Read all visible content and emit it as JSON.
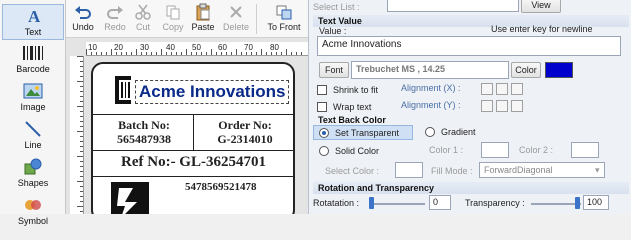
{
  "tools": [
    {
      "label": "Text",
      "icon": "text-tool-icon"
    },
    {
      "label": "Barcode",
      "icon": "barcode-icon"
    },
    {
      "label": "Image",
      "icon": "image-icon"
    },
    {
      "label": "Line",
      "icon": "line-icon"
    },
    {
      "label": "Shapes",
      "icon": "shapes-icon"
    },
    {
      "label": "Symbol",
      "icon": "symbol-icon"
    }
  ],
  "toolbar": {
    "undo": "Undo",
    "redo": "Redo",
    "cut": "Cut",
    "copy": "Copy",
    "paste": "Paste",
    "delete": "Delete",
    "to_front": "To Front"
  },
  "ruler": {
    "labels": [
      "10",
      "20",
      "30",
      "40",
      "50",
      "60",
      "70",
      "80"
    ]
  },
  "label": {
    "company": "Acme Innovations",
    "batch_title": "Batch No:",
    "batch_value": "565487938",
    "order_title": "Order No:",
    "order_value": "G-2314010",
    "ref": "Ref No:-  GL-36254701",
    "barcode_number": "5478569521478"
  },
  "panel": {
    "select_list_label": "Select List :",
    "view_button": "View",
    "text_value_header": "Text Value",
    "value_label": "Value :",
    "hint": "Use enter key for newline",
    "value_text": "Acme Innovations",
    "font_button": "Font",
    "font_display": "Trebuchet MS , 14.25",
    "color_button": "Color",
    "color_swatch": "#0000cc",
    "shrink_label": "Shrink to fit",
    "wrap_label": "Wrap text",
    "align_x_label": "Alignment (X) :",
    "align_y_label": "Alignment (Y) :",
    "back_color_header": "Text Back Color",
    "set_transparent": "Set Transparent",
    "gradient": "Gradient",
    "solid_color": "Solid Color",
    "color1": "Color 1 :",
    "color2": "Color 2 :",
    "select_color": "Select Color :",
    "fill_mode": "Fill Mode :",
    "fill_mode_value": "ForwardDiagonal",
    "rotation_header": "Rotation and Transparency",
    "rotation_label": "Rotatation :",
    "rotation_value": "0",
    "transparency_label": "Transparency :",
    "transparency_value": "100"
  }
}
